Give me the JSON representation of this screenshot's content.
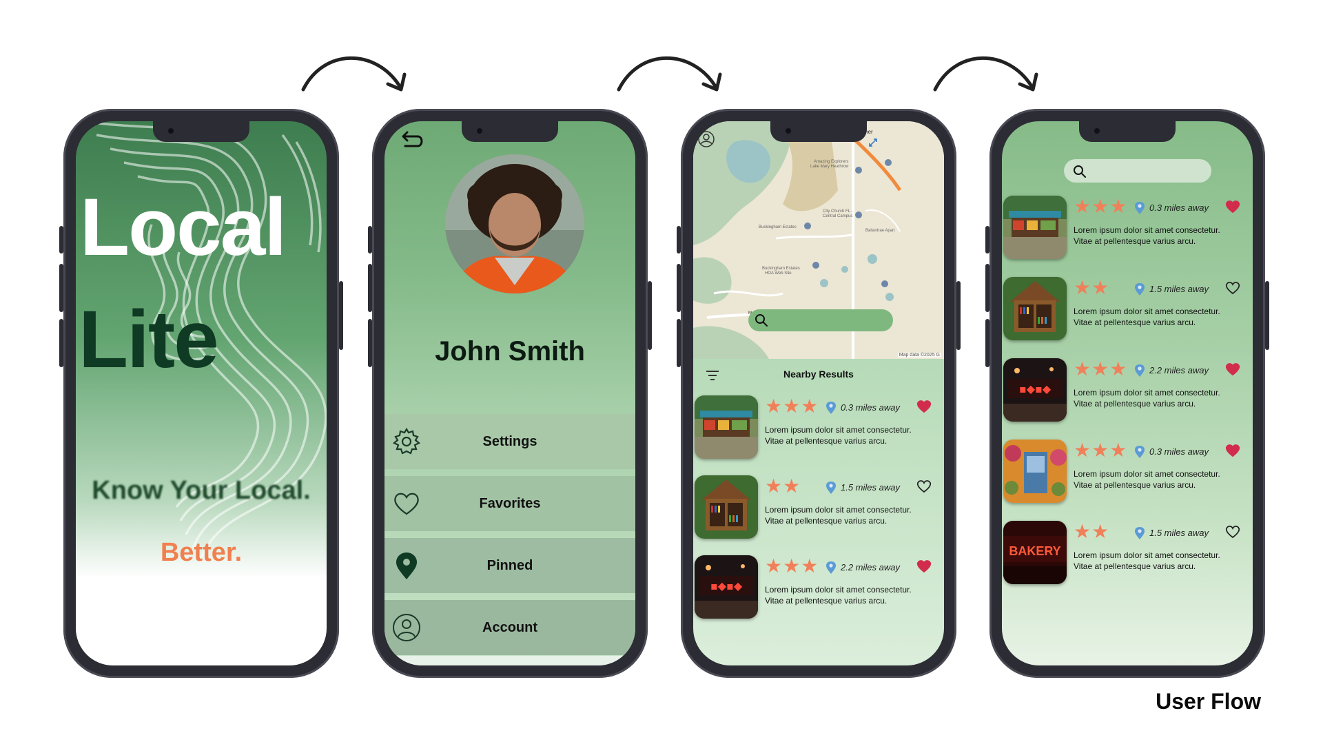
{
  "splash": {
    "title_line1": "Local",
    "title_line2": "Lite",
    "tagline": "Know Your Local.",
    "tagline_accent": "Better."
  },
  "profile": {
    "name": "John Smith",
    "menu": [
      {
        "label": "Settings",
        "icon": "gear-icon"
      },
      {
        "label": "Favorites",
        "icon": "heart-icon"
      },
      {
        "label": "Pinned",
        "icon": "map-pin-icon"
      },
      {
        "label": "Account",
        "icon": "user-icon"
      }
    ]
  },
  "map_screen": {
    "map_labels": [
      "Wilson Corner",
      "Amazing Explorers Lake Mary Heathrow",
      "Buckingham Estates",
      "City Church FL - Central Campus",
      "Ballantrae Apart",
      "Buckingham Estates HOA Web Site",
      "Markham Rd",
      "Map data ©2025 G"
    ],
    "nearby_title": "Nearby Results",
    "results": [
      {
        "stars": "★★★",
        "rating": 3,
        "distance": "0.3 miles away",
        "favorited": true,
        "text": "Lorem ipsum dolor sit amet consectetur. Vitae at pellentesque varius arcu."
      },
      {
        "stars": "★★",
        "rating": 2,
        "distance": "1.5 miles away",
        "favorited": false,
        "text": "Lorem ipsum dolor sit amet consectetur. Vitae at pellentesque varius arcu."
      },
      {
        "stars": "★★★",
        "rating": 3,
        "distance": "2.2 miles away",
        "favorited": true,
        "text": "Lorem ipsum dolor sit amet consectetur. Vitae at pellentesque varius arcu."
      }
    ]
  },
  "list_screen": {
    "results": [
      {
        "stars": "★★★",
        "rating": 3,
        "distance": "0.3 miles away",
        "favorited": true,
        "text": "Lorem ipsum dolor sit amet consectetur. Vitae at pellentesque varius arcu."
      },
      {
        "stars": "★★",
        "rating": 2,
        "distance": "1.5 miles away",
        "favorited": false,
        "text": "Lorem ipsum dolor sit amet consectetur. Vitae at pellentesque varius arcu."
      },
      {
        "stars": "★★★",
        "rating": 3,
        "distance": "2.2 miles away",
        "favorited": true,
        "text": "Lorem ipsum dolor sit amet consectetur. Vitae at pellentesque varius arcu."
      },
      {
        "stars": "★★★",
        "rating": 3,
        "distance": "0.3 miles away",
        "favorited": true,
        "text": "Lorem ipsum dolor sit amet consectetur. Vitae at pellentesque varius arcu."
      },
      {
        "stars": "★★",
        "rating": 2,
        "distance": "1.5 miles away",
        "favorited": false,
        "text": "Lorem ipsum dolor sit amet consectetur. Vitae at pellentesque varius arcu."
      }
    ]
  },
  "thumb_sign_text": "BAKERY",
  "caption": "User Flow",
  "colors": {
    "brand_green": "#3e7d4f",
    "accent_orange": "#f0804f",
    "star_color": "#f0805a",
    "heart_color": "#d22c4c",
    "dark_text": "#0f3a24"
  }
}
